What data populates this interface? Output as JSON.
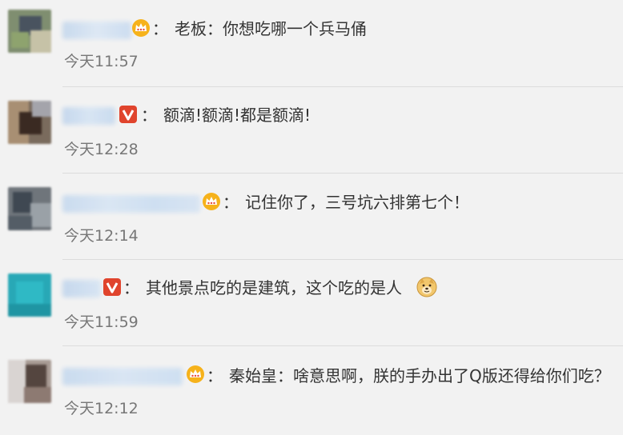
{
  "comments": [
    {
      "colon": "：",
      "text": "老板：你想吃哪一个兵马俑",
      "time": "今天11:57",
      "badge": "crown-icon"
    },
    {
      "colon": "：",
      "text": "额滴!额滴!都是额滴!",
      "time": "今天12:28",
      "badge": "verified-v-icon"
    },
    {
      "colon": "：",
      "text": "记住你了，三号坑六排第七个！",
      "time": "今天12:14",
      "badge": "crown-icon"
    },
    {
      "colon": "：",
      "text": "其他景点吃的是建筑，这个吃的是人",
      "time": "今天11:59",
      "badge": "verified-v-icon",
      "emoji": "doge-emoji"
    },
    {
      "colon": "：",
      "text": "秦始皇：啥意思啊，朕的手办出了Q版还得给你们吃？",
      "time": "今天12:12",
      "badge": "crown-icon"
    }
  ],
  "colors": {
    "background": "#f2f2f2",
    "text": "#333333",
    "time": "#777777",
    "divider": "#dcdcdc",
    "crown": "#f6b21b",
    "vip_badge": "#e0442d"
  }
}
